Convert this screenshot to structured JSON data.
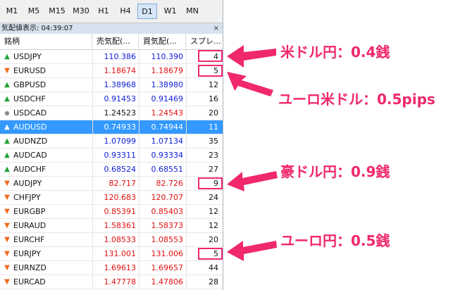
{
  "timeframes": [
    "M1",
    "M5",
    "M15",
    "M30",
    "H1",
    "H4",
    "D1",
    "W1",
    "MN"
  ],
  "active_timeframe": "D1",
  "window": {
    "title": "気配値表示: 04:39:07",
    "close_glyph": "×"
  },
  "columns": {
    "symbol": "銘柄",
    "bid": "売気配(...",
    "ask": "買気配(...",
    "spread": "スプレ..."
  },
  "rows": [
    {
      "symbol": "USDJPY",
      "bid": "110.386",
      "ask": "110.390",
      "spread": "4",
      "dir": "up",
      "color": "blue"
    },
    {
      "symbol": "EURUSD",
      "bid": "1.18674",
      "ask": "1.18679",
      "spread": "5",
      "dir": "down",
      "color": "red"
    },
    {
      "symbol": "GBPUSD",
      "bid": "1.38968",
      "ask": "1.38980",
      "spread": "12",
      "dir": "up",
      "color": "blue"
    },
    {
      "symbol": "USDCHF",
      "bid": "0.91453",
      "ask": "0.91469",
      "spread": "16",
      "dir": "up",
      "color": "blue"
    },
    {
      "symbol": "USDCAD",
      "bid": "1.24523",
      "ask": "1.24543",
      "spread": "20",
      "dir": "flat",
      "color": "mixed"
    },
    {
      "symbol": "AUDUSD",
      "bid": "0.74933",
      "ask": "0.74944",
      "spread": "11",
      "dir": "up",
      "color": "blue",
      "selected": true
    },
    {
      "symbol": "AUDNZD",
      "bid": "1.07099",
      "ask": "1.07134",
      "spread": "35",
      "dir": "up",
      "color": "blue"
    },
    {
      "symbol": "AUDCAD",
      "bid": "0.93311",
      "ask": "0.93334",
      "spread": "23",
      "dir": "up",
      "color": "blue"
    },
    {
      "symbol": "AUDCHF",
      "bid": "0.68524",
      "ask": "0.68551",
      "spread": "27",
      "dir": "up",
      "color": "blue"
    },
    {
      "symbol": "AUDJPY",
      "bid": "82.717",
      "ask": "82.726",
      "spread": "9",
      "dir": "down",
      "color": "red"
    },
    {
      "symbol": "CHFJPY",
      "bid": "120.683",
      "ask": "120.707",
      "spread": "24",
      "dir": "down",
      "color": "red"
    },
    {
      "symbol": "EURGBP",
      "bid": "0.85391",
      "ask": "0.85403",
      "spread": "12",
      "dir": "down",
      "color": "red"
    },
    {
      "symbol": "EURAUD",
      "bid": "1.58361",
      "ask": "1.58373",
      "spread": "12",
      "dir": "down",
      "color": "red"
    },
    {
      "symbol": "EURCHF",
      "bid": "1.08533",
      "ask": "1.08553",
      "spread": "20",
      "dir": "down",
      "color": "red"
    },
    {
      "symbol": "EURJPY",
      "bid": "131.001",
      "ask": "131.006",
      "spread": "5",
      "dir": "down",
      "color": "red"
    },
    {
      "symbol": "EURNZD",
      "bid": "1.69613",
      "ask": "1.69657",
      "spread": "44",
      "dir": "down",
      "color": "red"
    },
    {
      "symbol": "EURCAD",
      "bid": "1.47778",
      "ask": "1.47806",
      "spread": "28",
      "dir": "down",
      "color": "red"
    }
  ],
  "annotations": [
    {
      "text": "米ドル円：0.4銭"
    },
    {
      "text": "ユーロ米ドル：0.5pips"
    },
    {
      "text": "豪ドル円：0.9銭"
    },
    {
      "text": "ユーロ円：0.5銭"
    }
  ],
  "colors": {
    "accent": "#f0286e",
    "selected_row": "#3399ff",
    "price_up": "#1020d8",
    "price_down": "#e01010"
  }
}
